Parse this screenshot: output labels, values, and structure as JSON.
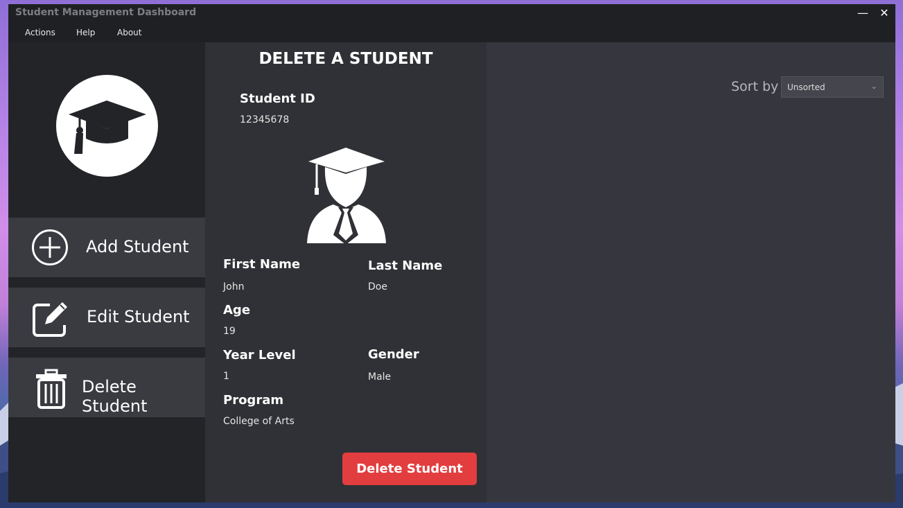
{
  "window": {
    "title": "Student Management Dashboard",
    "minimize": "—",
    "close": "✕"
  },
  "menu": [
    "Actions",
    "Help",
    "About"
  ],
  "sidebar": {
    "logo_icon": "graduation-cap-icon",
    "items": [
      {
        "label": "Add Student",
        "icon": "plus-circle-icon"
      },
      {
        "label": "Edit Student",
        "icon": "edit-icon"
      },
      {
        "label": "Delete Student",
        "icon": "trash-icon"
      }
    ]
  },
  "form": {
    "title": "DELETE A STUDENT",
    "student_id": {
      "label": "Student ID",
      "value": "12345678"
    },
    "avatar_icon": "graduate-avatar-icon",
    "first_name": {
      "label": "First Name",
      "value": "John"
    },
    "last_name": {
      "label": "Last Name",
      "value": "Doe"
    },
    "age": {
      "label": "Age",
      "value": "19"
    },
    "year_level": {
      "label": "Year Level",
      "value": "1"
    },
    "gender": {
      "label": "Gender",
      "value": "Male"
    },
    "program": {
      "label": "Program",
      "value": "College of Arts"
    },
    "delete_button": "Delete Student"
  },
  "list": {
    "sort_label": "Sort by",
    "sort_value": "Unsorted"
  },
  "colors": {
    "accent_red": "#e23d3f",
    "panel_dark": "#232428",
    "panel_mid": "#303136",
    "panel_light": "#36373e"
  }
}
